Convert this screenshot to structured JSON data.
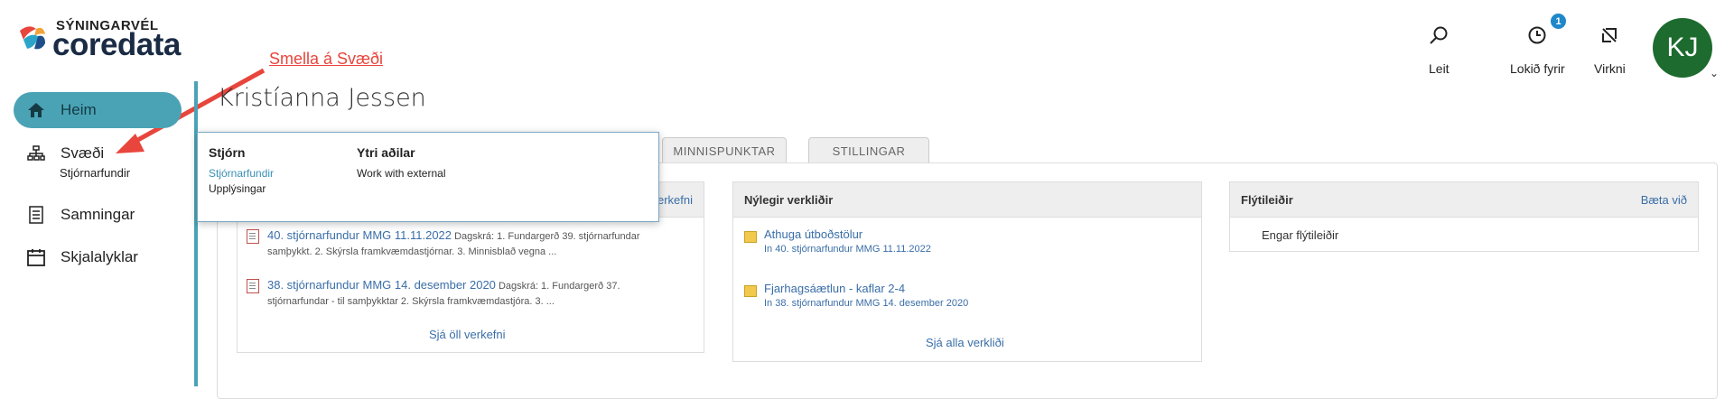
{
  "logo": {
    "top": "SÝNINGARVÉL",
    "main": "coredata"
  },
  "annotation": "Smella á Svæði",
  "sidebar": {
    "items": [
      {
        "label": "Heim",
        "icon": "home-icon"
      },
      {
        "label": "Svæði",
        "icon": "sitemap-icon",
        "sub": "Stjórnarfundir"
      },
      {
        "label": "Samningar",
        "icon": "document-icon"
      },
      {
        "label": "Skjalalyklar",
        "icon": "calendar-icon"
      }
    ]
  },
  "header": {
    "search_label": "Leit",
    "recent_label": "Lokið fyrir",
    "recent_badge": "1",
    "activity_label": "Virkni",
    "avatar_initials": "KJ"
  },
  "page_title": "Kristíanna Jessen",
  "tabs": [
    "MINNISPUNKTAR",
    "STILLINGAR"
  ],
  "dropdown": {
    "col1": {
      "title": "Stjórn",
      "link": "Stjórnarfundir",
      "text": "Upplýsingar"
    },
    "col2": {
      "title": "Ytri aðilar",
      "text": "Work with external"
    }
  },
  "panel1": {
    "head_link": "verkefni",
    "items": [
      {
        "title": "40. stjórnarfundur MMG 11.11.2022",
        "desc1": "Dagskrá: 1. Fundargerð 39. stjórnarfundar",
        "desc2": "samþykkt. 2. Skýrsla framkvæmdastjórnar. 3. Minnisblað vegna ..."
      },
      {
        "title": "38. stjórnarfundur MMG 14. desember 2020",
        "desc1": "Dagskrá: 1. Fundargerð 37.",
        "desc2": "stjórnarfundar - til samþykktar 2. Skýrsla framkvæmdastjóra. 3. ..."
      }
    ],
    "footer": "Sjá öll verkefni"
  },
  "panel2": {
    "title": "Nýlegir verkliðir",
    "items": [
      {
        "title": "Athuga útboðstölur",
        "sub": "In 40. stjórnarfundur MMG 11.11.2022"
      },
      {
        "title": "Fjarhagsáætlun - kaflar 2-4",
        "sub": "In 38. stjórnarfundur MMG 14. desember 2020"
      }
    ],
    "footer": "Sjá alla verkliði"
  },
  "panel3": {
    "title": "Flýtileiðir",
    "add": "Bæta við",
    "empty": "Engar flýtileiðir"
  },
  "colors": {
    "accent": "#4aa3b5",
    "annotation": "#e8453c",
    "avatar": "#1d6b2e",
    "badge": "#1e88c9",
    "link": "#3a6ea8"
  }
}
